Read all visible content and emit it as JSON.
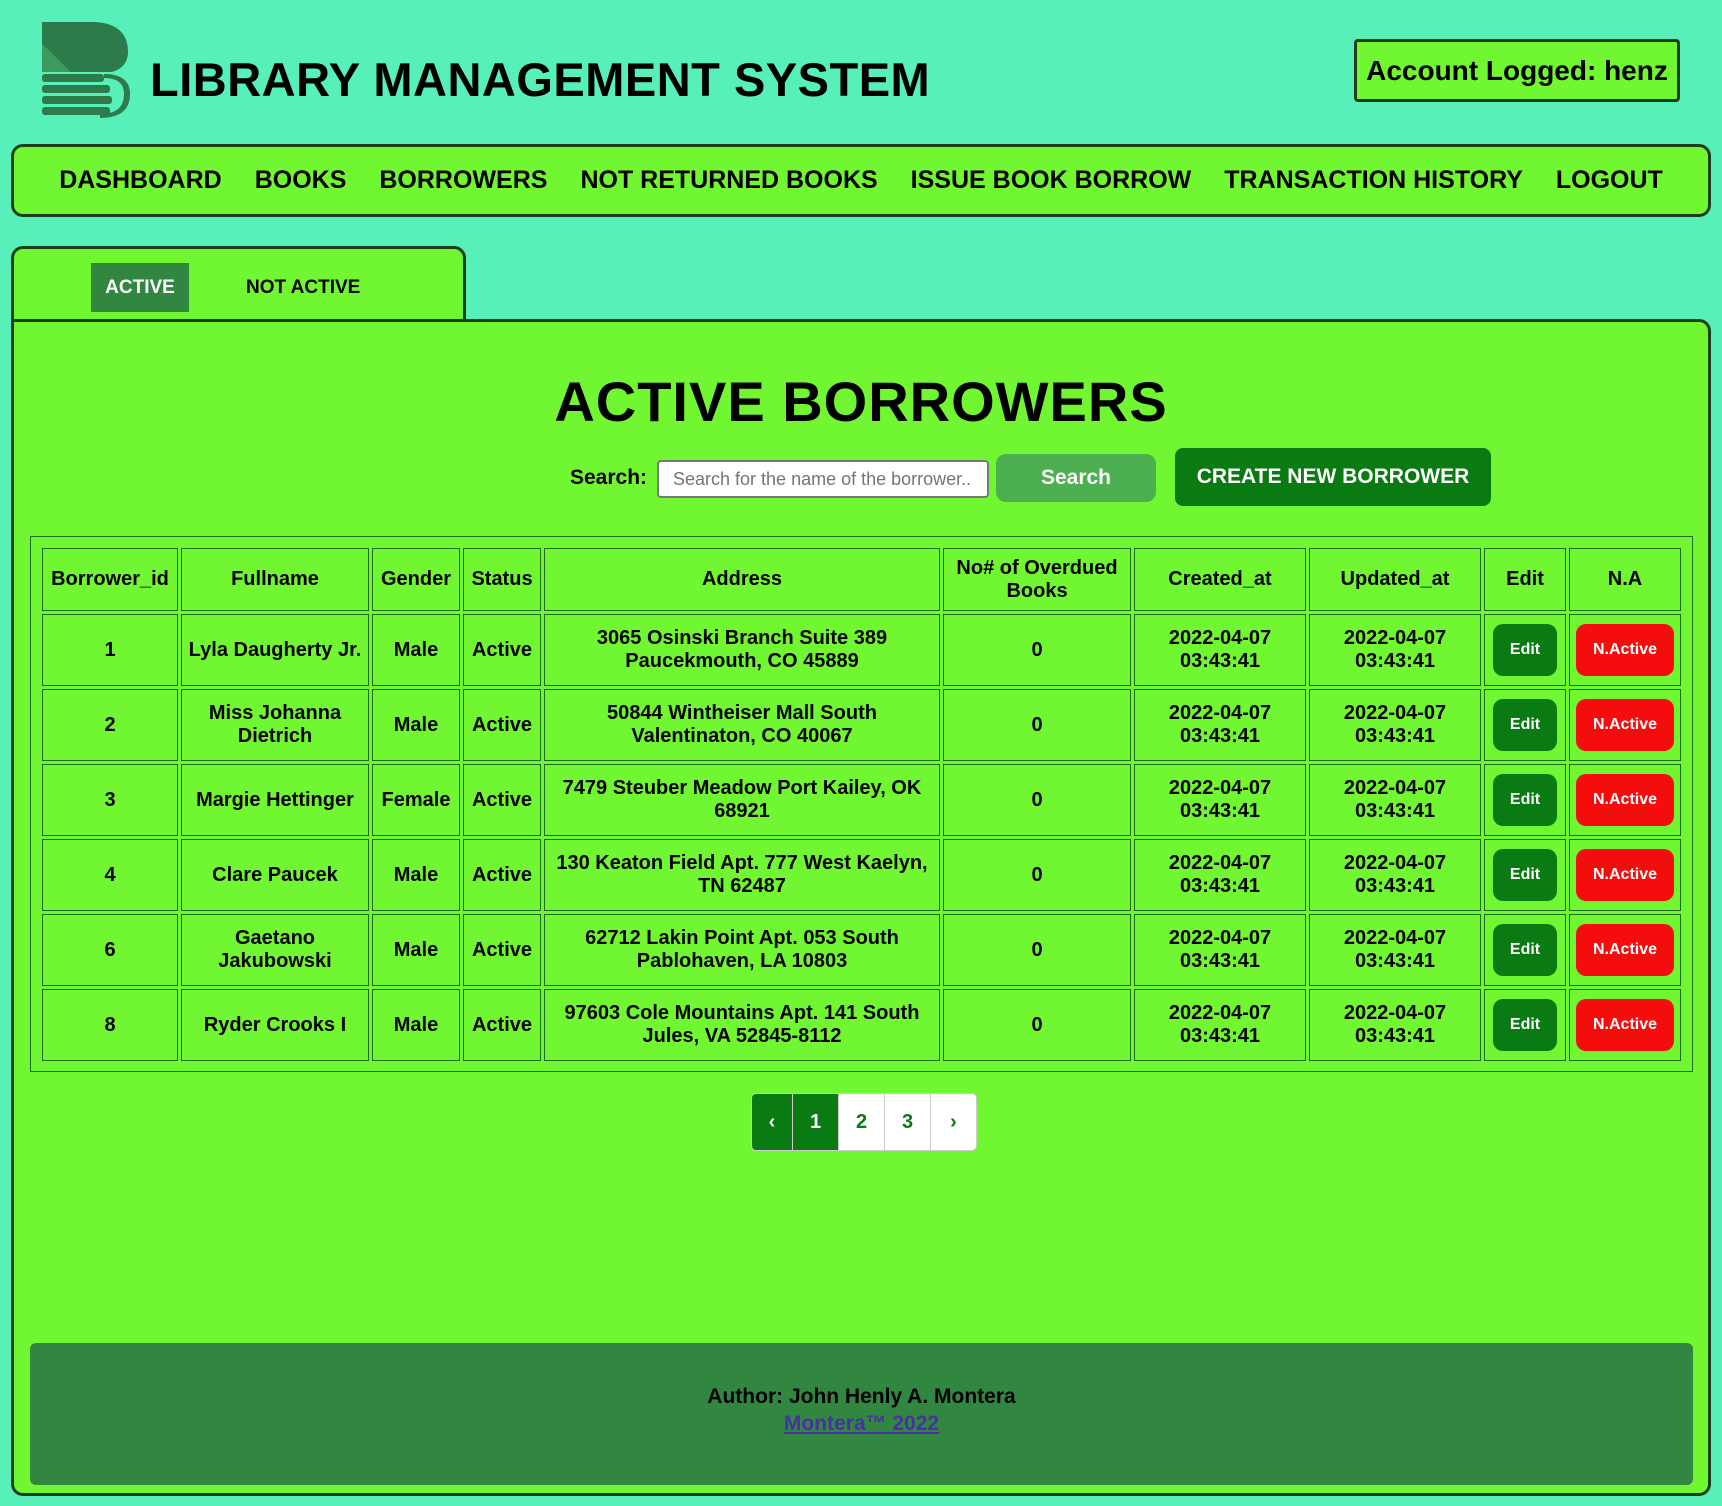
{
  "app": {
    "title": "LIBRARY MANAGEMENT SYSTEM",
    "account_label": "Account Logged: henz",
    "logo_icon": "book-stack-icon"
  },
  "nav": {
    "items": [
      {
        "label": "DASHBOARD"
      },
      {
        "label": "BOOKS"
      },
      {
        "label": "BORROWERS"
      },
      {
        "label": "NOT RETURNED BOOKS"
      },
      {
        "label": "ISSUE BOOK BORROW"
      },
      {
        "label": "TRANSACTION HISTORY"
      },
      {
        "label": "LOGOUT"
      }
    ]
  },
  "tabs": {
    "active": "ACTIVE",
    "inactive": "NOT ACTIVE"
  },
  "main": {
    "heading": "ACTIVE BORROWERS",
    "search_label": "Search:",
    "search_placeholder": "Search for the name of the borrower..",
    "search_value": "",
    "search_button": "Search",
    "create_button": "CREATE NEW BORROWER"
  },
  "table": {
    "headers": [
      "Borrower_id",
      "Fullname",
      "Gender",
      "Status",
      "Address",
      "No# of Overdued Books",
      "Created_at",
      "Updated_at",
      "Edit",
      "N.A"
    ],
    "rows": [
      {
        "id": "1",
        "fullname": "Lyla Daugherty Jr.",
        "gender": "Male",
        "status": "Active",
        "address": "3065 Osinski Branch Suite 389 Paucekmouth, CO 45889",
        "overdue": "0",
        "created_date": "2022-04-07",
        "created_time": "03:43:41",
        "updated_date": "2022-04-07",
        "updated_time": "03:43:41",
        "edit": "Edit",
        "na": "N.Active"
      },
      {
        "id": "2",
        "fullname": "Miss Johanna Dietrich",
        "gender": "Male",
        "status": "Active",
        "address": "50844 Wintheiser Mall South Valentinaton, CO 40067",
        "overdue": "0",
        "created_date": "2022-04-07",
        "created_time": "03:43:41",
        "updated_date": "2022-04-07",
        "updated_time": "03:43:41",
        "edit": "Edit",
        "na": "N.Active"
      },
      {
        "id": "3",
        "fullname": "Margie Hettinger",
        "gender": "Female",
        "status": "Active",
        "address": "7479 Steuber Meadow Port Kailey, OK 68921",
        "overdue": "0",
        "created_date": "2022-04-07",
        "created_time": "03:43:41",
        "updated_date": "2022-04-07",
        "updated_time": "03:43:41",
        "edit": "Edit",
        "na": "N.Active"
      },
      {
        "id": "4",
        "fullname": "Clare Paucek",
        "gender": "Male",
        "status": "Active",
        "address": "130 Keaton Field Apt. 777 West Kaelyn, TN 62487",
        "overdue": "0",
        "created_date": "2022-04-07",
        "created_time": "03:43:41",
        "updated_date": "2022-04-07",
        "updated_time": "03:43:41",
        "edit": "Edit",
        "na": "N.Active"
      },
      {
        "id": "6",
        "fullname": "Gaetano Jakubowski",
        "gender": "Male",
        "status": "Active",
        "address": "62712 Lakin Point Apt. 053 South Pablohaven, LA 10803",
        "overdue": "0",
        "created_date": "2022-04-07",
        "created_time": "03:43:41",
        "updated_date": "2022-04-07",
        "updated_time": "03:43:41",
        "edit": "Edit",
        "na": "N.Active"
      },
      {
        "id": "8",
        "fullname": "Ryder Crooks I",
        "gender": "Male",
        "status": "Active",
        "address": "97603 Cole Mountains Apt. 141 South Jules, VA 52845-8112",
        "overdue": "0",
        "created_date": "2022-04-07",
        "created_time": "03:43:41",
        "updated_date": "2022-04-07",
        "updated_time": "03:43:41",
        "edit": "Edit",
        "na": "N.Active"
      }
    ]
  },
  "pagination": {
    "prev": "‹",
    "pages": [
      "1",
      "2",
      "3"
    ],
    "current": "1",
    "next": "›"
  },
  "footer": {
    "author": "Author: John Henly A. Montera",
    "link": "Montera™ 2022"
  },
  "colors": {
    "page_background": "#57f0b8",
    "panel_green": "#71f731",
    "dark_green": "#0a7a12",
    "footer_green": "#31873f",
    "danger_red": "#f50d0d"
  }
}
